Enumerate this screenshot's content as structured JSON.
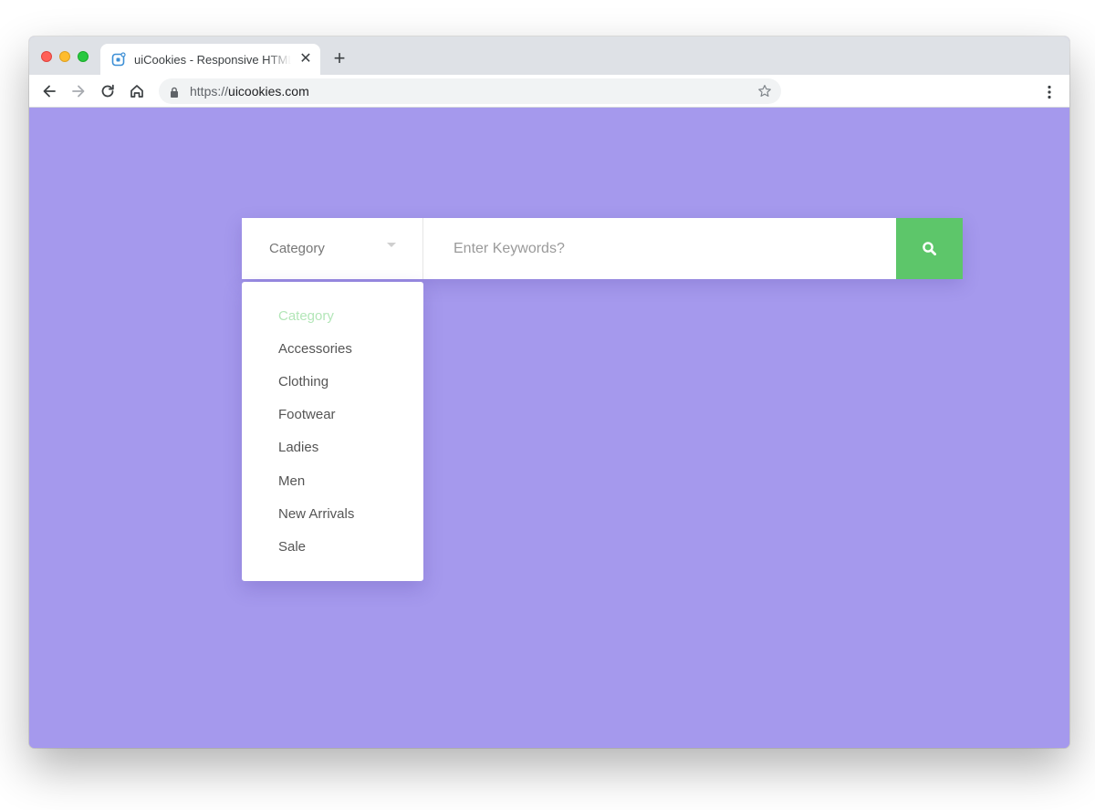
{
  "browser": {
    "tab_title": "uiCookies - Responsive HTML",
    "url_scheme": "https://",
    "url_host": "uicookies.com"
  },
  "search": {
    "category_label": "Category",
    "keyword_placeholder": "Enter Keywords?",
    "button_icon": "search-icon"
  },
  "dropdown": {
    "items": [
      "Category",
      "Accessories",
      "Clothing",
      "Footwear",
      "Ladies",
      "Men",
      "New Arrivals",
      "Sale"
    ],
    "selected": "Category"
  },
  "colors": {
    "page_background": "#a599ed",
    "search_button": "#5dc66a",
    "selected_item": "#b3e6b8"
  }
}
